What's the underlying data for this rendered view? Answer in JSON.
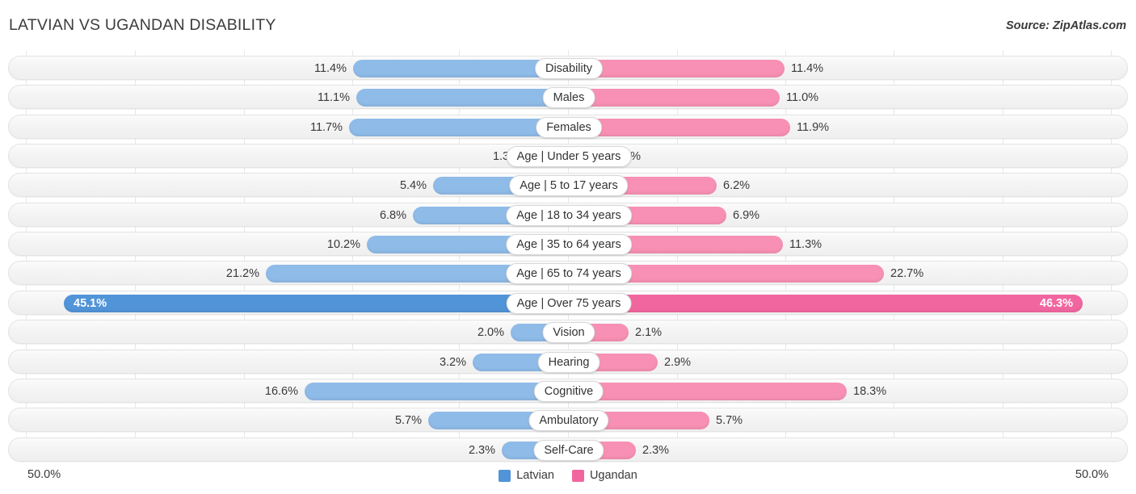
{
  "header": {
    "title": "LATVIAN VS UGANDAN DISABILITY",
    "source": "Source: ZipAtlas.com"
  },
  "axis": {
    "left_label": "50.0%",
    "right_label": "50.0%"
  },
  "legend": {
    "items": [
      {
        "label": "Latvian",
        "color": "#5194d8"
      },
      {
        "label": "Ugandan",
        "color": "#f2669f"
      }
    ]
  },
  "colors": {
    "left_bar": "#8fbbe8",
    "right_bar": "#f790b4",
    "left_bar_highlight": "#5194d8",
    "right_bar_highlight": "#f266a0",
    "track": "#f4f4f4",
    "text": "#3a3a3a"
  },
  "chart_data": {
    "type": "bar",
    "title": "LATVIAN VS UGANDAN DISABILITY",
    "subtitle": "",
    "xlabel": "",
    "ylabel": "",
    "orientation": "horizontal-diverging",
    "axis_max_percent": 50.0,
    "grid": true,
    "legend_position": "bottom-center",
    "series": [
      {
        "name": "Latvian",
        "side": "left",
        "values": [
          11.4,
          11.1,
          11.7,
          1.3,
          5.4,
          6.8,
          10.2,
          21.2,
          45.1,
          2.0,
          3.2,
          16.6,
          5.7,
          2.3
        ]
      },
      {
        "name": "Ugandan",
        "side": "right",
        "values": [
          11.4,
          11.0,
          11.9,
          1.1,
          6.2,
          6.9,
          11.3,
          22.7,
          46.3,
          2.1,
          2.9,
          18.3,
          5.7,
          2.3
        ]
      }
    ],
    "categories": [
      "Disability",
      "Males",
      "Females",
      "Age | Under 5 years",
      "Age | 5 to 17 years",
      "Age | 18 to 34 years",
      "Age | 35 to 64 years",
      "Age | 65 to 74 years",
      "Age | Over 75 years",
      "Vision",
      "Hearing",
      "Cognitive",
      "Ambulatory",
      "Self-Care"
    ]
  },
  "rows": [
    {
      "label": "Disability",
      "left": "11.4%",
      "right": "11.4%",
      "lw": 267,
      "rw": 267,
      "hl": false
    },
    {
      "label": "Males",
      "left": "11.1%",
      "right": "11.0%",
      "lw": 263,
      "rw": 261,
      "hl": false
    },
    {
      "label": "Females",
      "left": "11.7%",
      "right": "11.9%",
      "lw": 272,
      "rw": 274,
      "hl": false
    },
    {
      "label": "Age | Under 5 years",
      "left": "1.3%",
      "right": "1.1%",
      "lw": 53,
      "rw": 48,
      "hl": false
    },
    {
      "label": "Age | 5 to 17 years",
      "left": "5.4%",
      "right": "6.2%",
      "lw": 168,
      "rw": 183,
      "hl": false
    },
    {
      "label": "Age | 18 to 34 years",
      "left": "6.8%",
      "right": "6.9%",
      "lw": 193,
      "rw": 195,
      "hl": false
    },
    {
      "label": "Age | 35 to 64 years",
      "left": "10.2%",
      "right": "11.3%",
      "lw": 250,
      "rw": 265,
      "hl": false
    },
    {
      "label": "Age | 65 to 74 years",
      "left": "21.2%",
      "right": "22.7%",
      "lw": 375,
      "rw": 390,
      "hl": false
    },
    {
      "label": "Age | Over 75 years",
      "left": "45.1%",
      "right": "46.3%",
      "lw": 625,
      "rw": 636,
      "hl": true
    },
    {
      "label": "Vision",
      "left": "2.0%",
      "right": "2.1%",
      "lw": 72,
      "rw": 74,
      "hl": false
    },
    {
      "label": "Hearing",
      "left": "3.2%",
      "right": "2.9%",
      "lw": 119,
      "rw": 110,
      "hl": false
    },
    {
      "label": "Cognitive",
      "left": "16.6%",
      "right": "18.3%",
      "lw": 327,
      "rw": 344,
      "hl": false
    },
    {
      "label": "Ambulatory",
      "left": "5.7%",
      "right": "5.7%",
      "lw": 174,
      "rw": 174,
      "hl": false
    },
    {
      "label": "Self-Care",
      "left": "2.3%",
      "right": "2.3%",
      "lw": 83,
      "rw": 83,
      "hl": false
    }
  ]
}
